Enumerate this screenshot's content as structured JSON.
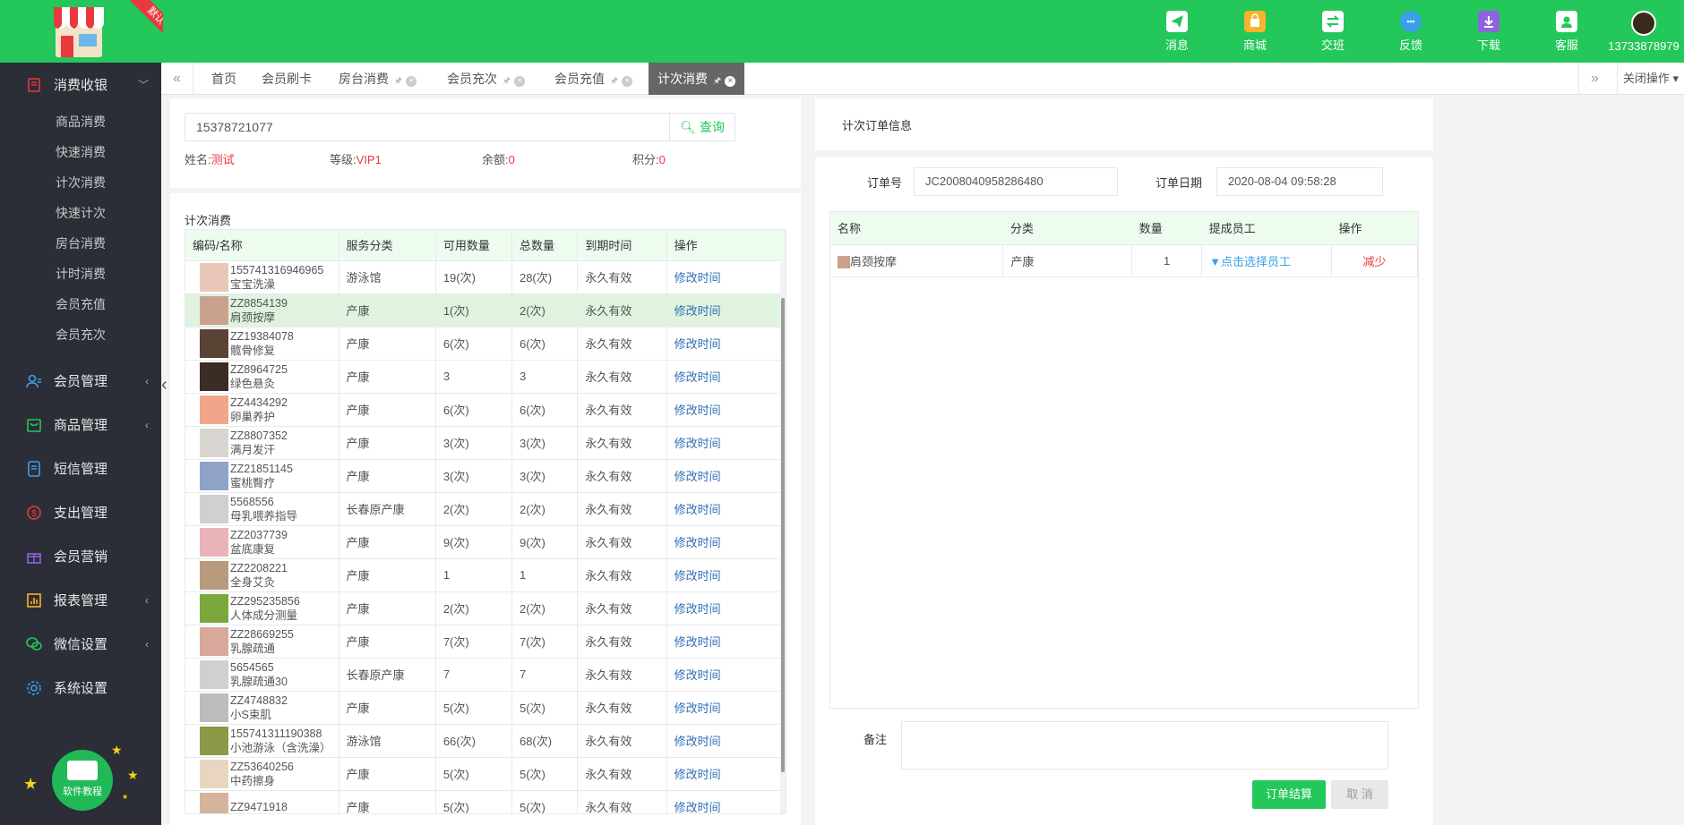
{
  "header": {
    "ribbon": "默认",
    "nav": [
      {
        "label": "消息",
        "icon": "send-icon"
      },
      {
        "label": "商城",
        "icon": "shop-icon"
      },
      {
        "label": "交班",
        "icon": "swap-icon"
      },
      {
        "label": "反馈",
        "icon": "chat-icon"
      },
      {
        "label": "下载",
        "icon": "download-icon"
      },
      {
        "label": "客服",
        "icon": "service-icon"
      }
    ],
    "user": "13733878979"
  },
  "sidebar": {
    "group_open": "消费收银",
    "subitems": [
      "商品消费",
      "快速消费",
      "计次消费",
      "快速计次",
      "房台消费",
      "计时消费",
      "会员充值",
      "会员充次"
    ],
    "groups": [
      {
        "label": "会员管理",
        "icon": "member-icon"
      },
      {
        "label": "商品管理",
        "icon": "goods-icon"
      },
      {
        "label": "短信管理",
        "icon": "sms-icon"
      },
      {
        "label": "支出管理",
        "icon": "money-icon"
      },
      {
        "label": "会员营销",
        "icon": "gift-icon"
      },
      {
        "label": "报表管理",
        "icon": "report-icon"
      },
      {
        "label": "微信设置",
        "icon": "wechat-icon"
      },
      {
        "label": "系统设置",
        "icon": "gear-icon"
      }
    ],
    "tutorial": "软件教程"
  },
  "tabs": {
    "items": [
      "首页",
      "会员刷卡",
      "房台消费",
      "会员充次",
      "会员充值",
      "计次消费"
    ],
    "active": 5,
    "close_ops": "关闭操作"
  },
  "member": {
    "search_value": "15378721077",
    "search_btn": "查询",
    "name_label": "姓名:",
    "name": "测试",
    "level_label": "等级:",
    "level": "VIP1",
    "balance_label": "余额:",
    "balance": "0",
    "points_label": "积分:",
    "points": "0"
  },
  "list": {
    "title": "计次消费",
    "headers": [
      "编码/名称",
      "服务分类",
      "可用数量",
      "总数量",
      "到期时间",
      "操作"
    ],
    "action": "修改时间",
    "rows": [
      {
        "code": "155741316946965",
        "name": "宝宝洗澡",
        "cat": "游泳馆",
        "avail": "19(次)",
        "total": "28(次)",
        "expire": "永久有效",
        "c": "#e9c7b8"
      },
      {
        "code": "ZZ8854139",
        "name": "肩颈按摩",
        "cat": "产康",
        "avail": "1(次)",
        "total": "2(次)",
        "expire": "永久有效",
        "c": "#c9a28e"
      },
      {
        "code": "ZZ19384078",
        "name": "髋骨修复",
        "cat": "产康",
        "avail": "6(次)",
        "total": "6(次)",
        "expire": "永久有效",
        "c": "#5a4234"
      },
      {
        "code": "ZZ8964725",
        "name": "绿色悬灸",
        "cat": "产康",
        "avail": "3",
        "total": "3",
        "expire": "永久有效",
        "c": "#3b2d26"
      },
      {
        "code": "ZZ4434292",
        "name": "卵巢养护",
        "cat": "产康",
        "avail": "6(次)",
        "total": "6(次)",
        "expire": "永久有效",
        "c": "#f1a58a"
      },
      {
        "code": "ZZ8807352",
        "name": "满月发汗",
        "cat": "产康",
        "avail": "3(次)",
        "total": "3(次)",
        "expire": "永久有效",
        "c": "#d9d5d0"
      },
      {
        "code": "ZZ21851145",
        "name": "蜜桃臀疗",
        "cat": "产康",
        "avail": "3(次)",
        "total": "3(次)",
        "expire": "永久有效",
        "c": "#8fa3c8"
      },
      {
        "code": "5568556",
        "name": "母乳喂养指导",
        "cat": "长春原产康",
        "avail": "2(次)",
        "total": "2(次)",
        "expire": "永久有效",
        "c": "#d0d0d0"
      },
      {
        "code": "ZZ2037739",
        "name": "盆底康复",
        "cat": "产康",
        "avail": "9(次)",
        "total": "9(次)",
        "expire": "永久有效",
        "c": "#e8b4b8"
      },
      {
        "code": "ZZ2208221",
        "name": "全身艾灸",
        "cat": "产康",
        "avail": "1",
        "total": "1",
        "expire": "永久有效",
        "c": "#b89a7c"
      },
      {
        "code": "ZZ295235856",
        "name": "人体成分测量",
        "cat": "产康",
        "avail": "2(次)",
        "total": "2(次)",
        "expire": "永久有效",
        "c": "#7aa83c"
      },
      {
        "code": "ZZ28669255",
        "name": "乳腺疏通",
        "cat": "产康",
        "avail": "7(次)",
        "total": "7(次)",
        "expire": "永久有效",
        "c": "#d8a89a"
      },
      {
        "code": "5654565",
        "name": "乳腺疏通30",
        "cat": "长春原产康",
        "avail": "7",
        "total": "7",
        "expire": "永久有效",
        "c": "#d0d0d0"
      },
      {
        "code": "ZZ4748832",
        "name": "小S束肌",
        "cat": "产康",
        "avail": "5(次)",
        "total": "5(次)",
        "expire": "永久有效",
        "c": "#bcbcbc"
      },
      {
        "code": "155741311190388",
        "name": "小池游泳（含洗澡）",
        "cat": "游泳馆",
        "avail": "66(次)",
        "total": "68(次)",
        "expire": "永久有效",
        "c": "#8b9a46"
      },
      {
        "code": "ZZ53640256",
        "name": "中药擦身",
        "cat": "产康",
        "avail": "5(次)",
        "total": "5(次)",
        "expire": "永久有效",
        "c": "#e8d6c0"
      },
      {
        "code": "ZZ9471918",
        "name": "",
        "cat": "产康",
        "avail": "5(次)",
        "total": "5(次)",
        "expire": "永久有效",
        "c": "#d4b49a"
      }
    ]
  },
  "order": {
    "title": "计次订单信息",
    "no_label": "订单号",
    "no_value": "JC2008040958286480",
    "date_label": "订单日期",
    "date_value": "2020-08-04 09:58:28",
    "headers": [
      "名称",
      "分类",
      "数量",
      "提成员工",
      "操作"
    ],
    "rows": [
      {
        "name": "肩颈按摩",
        "cat": "产康",
        "qty": "1",
        "staff": "▼点击选择员工",
        "op": "减少"
      }
    ],
    "remark_label": "备注",
    "submit": "订单结算",
    "cancel": "取 消"
  }
}
